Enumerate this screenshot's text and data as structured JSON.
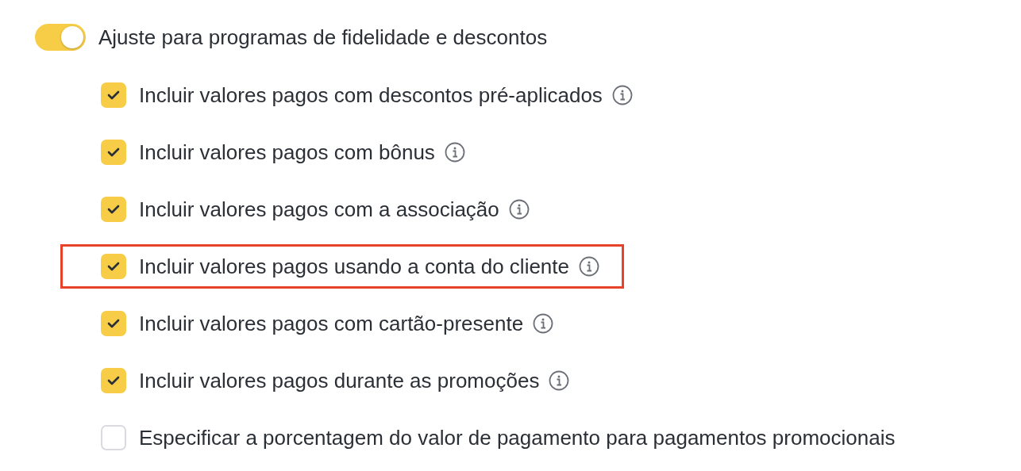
{
  "toggle": {
    "label": "Ajuste para programas de fidelidade e descontos",
    "on": true
  },
  "options": [
    {
      "label": "Incluir valores pagos com descontos pré-aplicados",
      "checked": true,
      "info": true,
      "highlighted": false
    },
    {
      "label": "Incluir valores pagos com bônus",
      "checked": true,
      "info": true,
      "highlighted": false
    },
    {
      "label": "Incluir valores pagos com a associação",
      "checked": true,
      "info": true,
      "highlighted": false
    },
    {
      "label": "Incluir valores pagos usando a conta do cliente",
      "checked": true,
      "info": true,
      "highlighted": true
    },
    {
      "label": "Incluir valores pagos com cartão-presente",
      "checked": true,
      "info": true,
      "highlighted": false
    },
    {
      "label": "Incluir valores pagos durante as promoções",
      "checked": true,
      "info": true,
      "highlighted": false
    },
    {
      "label": "Especificar a porcentagem do valor de pagamento para pagamentos promocionais",
      "checked": false,
      "info": false,
      "highlighted": false
    }
  ]
}
